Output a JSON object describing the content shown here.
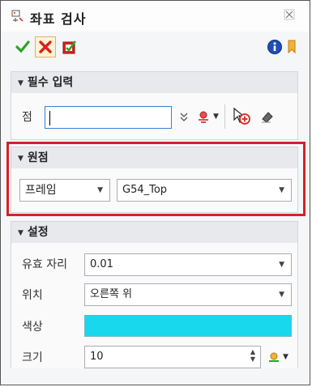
{
  "window": {
    "title": "좌표 검사"
  },
  "sections": {
    "required": {
      "title": "필수 입력",
      "point_label": "점",
      "point_value": ""
    },
    "origin": {
      "title": "원점",
      "type_value": "프레임",
      "frame_value": "G54_Top"
    },
    "settings": {
      "title": "설정",
      "digits_label": "유효 자리",
      "digits_value": "0.01",
      "position_label": "위치",
      "position_value": "오른쪽 위",
      "color_label": "색상",
      "color_value": "#18d8ee",
      "size_label": "크기",
      "size_value": "10"
    }
  },
  "colors": {
    "highlight": "#d8202a",
    "check": "#2aa52a",
    "cancel": "#d9231d"
  }
}
